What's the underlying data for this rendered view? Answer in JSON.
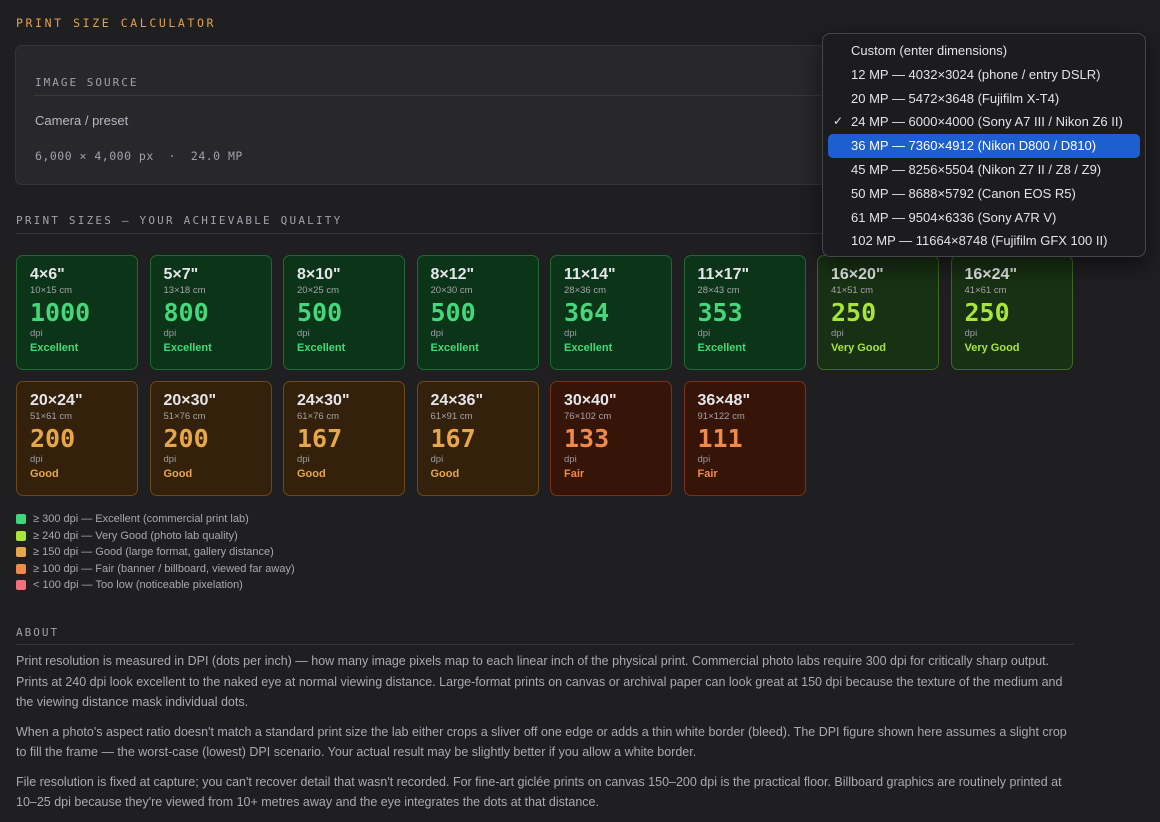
{
  "app": {
    "title": "PRINT SIZE CALCULATOR"
  },
  "source": {
    "label": "IMAGE SOURCE",
    "camera_label": "Camera / preset",
    "resolution_line": "6,000 × 4,000 px  ·  24.0 MP"
  },
  "print_sizes": {
    "title": "PRINT SIZES — YOUR ACHIEVABLE QUALITY",
    "tiles": [
      {
        "size": "4×6\"",
        "cm": "10×15 cm",
        "dpi": "1000",
        "unit": "dpi",
        "grade": "Excellent",
        "level": "excellent"
      },
      {
        "size": "5×7\"",
        "cm": "13×18 cm",
        "dpi": "800",
        "unit": "dpi",
        "grade": "Excellent",
        "level": "excellent"
      },
      {
        "size": "8×10\"",
        "cm": "20×25 cm",
        "dpi": "500",
        "unit": "dpi",
        "grade": "Excellent",
        "level": "excellent"
      },
      {
        "size": "8×12\"",
        "cm": "20×30 cm",
        "dpi": "500",
        "unit": "dpi",
        "grade": "Excellent",
        "level": "excellent"
      },
      {
        "size": "11×14\"",
        "cm": "28×36 cm",
        "dpi": "364",
        "unit": "dpi",
        "grade": "Excellent",
        "level": "excellent"
      },
      {
        "size": "11×17\"",
        "cm": "28×43 cm",
        "dpi": "353",
        "unit": "dpi",
        "grade": "Excellent",
        "level": "excellent"
      },
      {
        "size": "16×20\"",
        "cm": "41×51 cm",
        "dpi": "250",
        "unit": "dpi",
        "grade": "Very Good",
        "level": "verygood"
      },
      {
        "size": "16×24\"",
        "cm": "41×61 cm",
        "dpi": "250",
        "unit": "dpi",
        "grade": "Very Good",
        "level": "verygood"
      },
      {
        "size": "20×24\"",
        "cm": "51×61 cm",
        "dpi": "200",
        "unit": "dpi",
        "grade": "Good",
        "level": "good"
      },
      {
        "size": "20×30\"",
        "cm": "51×76 cm",
        "dpi": "200",
        "unit": "dpi",
        "grade": "Good",
        "level": "good"
      },
      {
        "size": "24×30\"",
        "cm": "61×76 cm",
        "dpi": "167",
        "unit": "dpi",
        "grade": "Good",
        "level": "good"
      },
      {
        "size": "24×36\"",
        "cm": "61×91 cm",
        "dpi": "167",
        "unit": "dpi",
        "grade": "Good",
        "level": "good"
      },
      {
        "size": "30×40\"",
        "cm": "76×102 cm",
        "dpi": "133",
        "unit": "dpi",
        "grade": "Fair",
        "level": "fair"
      },
      {
        "size": "36×48\"",
        "cm": "91×122 cm",
        "dpi": "111",
        "unit": "dpi",
        "grade": "Fair",
        "level": "fair"
      }
    ]
  },
  "legend": [
    {
      "text": "≥ 300 dpi — Excellent (commercial print lab)",
      "color": "#3ad87a"
    },
    {
      "text": "≥ 240 dpi — Very Good (photo lab quality)",
      "color": "#a7e53a"
    },
    {
      "text": "≥ 150 dpi — Good (large format, gallery distance)",
      "color": "#e8a64a"
    },
    {
      "text": "≥ 100 dpi — Fair (banner / billboard, viewed far away)",
      "color": "#f08a48"
    },
    {
      "text": "< 100 dpi — Too low (noticeable pixelation)",
      "color": "#f2707a"
    }
  ],
  "about": {
    "title": "ABOUT",
    "paragraphs": [
      "Print resolution is measured in DPI (dots per inch) — how many image pixels map to each linear inch of the physical print. Commercial photo labs require 300 dpi for critically sharp output. Prints at 240 dpi look excellent to the naked eye at normal viewing distance. Large-format prints on canvas or archival paper can look great at 150 dpi because the texture of the medium and the viewing distance mask individual dots.",
      "When a photo's aspect ratio doesn't match a standard print size the lab either crops a sliver off one edge or adds a thin white border (bleed). The DPI figure shown here assumes a slight crop to fill the frame — the worst-case (lowest) DPI scenario. Your actual result may be slightly better if you allow a white border.",
      "File resolution is fixed at capture; you can't recover detail that wasn't recorded. For fine-art giclée prints on canvas 150–200 dpi is the practical floor. Billboard graphics are routinely printed at 10–25 dpi because they're viewed from 10+ metres away and the eye integrates the dots at that distance."
    ]
  },
  "camera_dropdown": {
    "checked_index": 3,
    "highlighted_index": 4,
    "check_glyph": "✓",
    "options": [
      "Custom (enter dimensions)",
      "12 MP — 4032×3024 (phone / entry DSLR)",
      "20 MP — 5472×3648 (Fujifilm X-T4)",
      "24 MP — 6000×4000 (Sony A7 III / Nikon Z6 II)",
      "36 MP — 7360×4912 (Nikon D800 / D810)",
      "45 MP — 8256×5504 (Nikon Z7 II / Z8 / Z9)",
      "50 MP — 8688×5792 (Canon EOS R5)",
      "61 MP — 9504×6336 (Sony A7R V)",
      "102 MP — 11664×8748 (Fujifilm GFX 100 II)"
    ]
  }
}
